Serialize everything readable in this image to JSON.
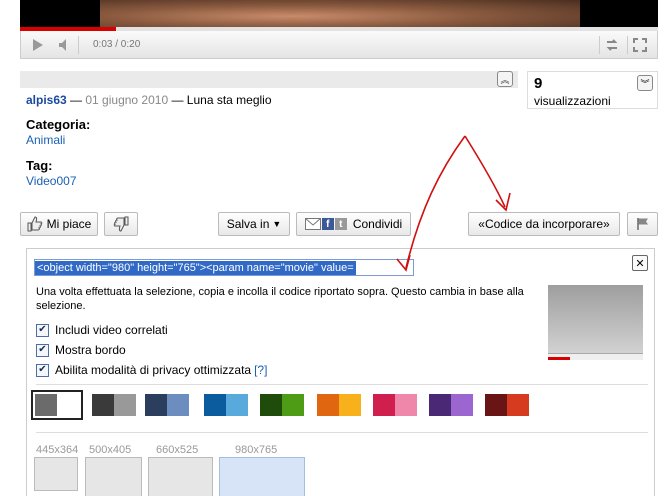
{
  "player": {
    "time": "0:03 / 0:20",
    "played_fraction": 0.15
  },
  "info": {
    "views_count": "9",
    "views_label": "visualizzazioni",
    "username": "alpis63",
    "sep1": " — ",
    "date": "01 giugno 2010",
    "sep2": " — ",
    "title": "Luna sta meglio",
    "category_label": "Categoria:",
    "category_value": "Animali",
    "tag_label": "Tag:",
    "tag_value": "Video007"
  },
  "actions": {
    "like_label": "Mi piace",
    "save_label": "Salva in",
    "share_label": "Condividi",
    "embed_label": "«Codice da incorporare»"
  },
  "embed": {
    "code": "<object width=\"980\" height=\"765\"><param name=\"movie\" value=",
    "description": "Una volta effettuata la selezione, copia e incolla il codice riportato sopra. Questo cambia in base alla selezione.",
    "options": [
      {
        "label": "Includi video correlati",
        "checked": true
      },
      {
        "label": "Mostra bordo",
        "checked": true
      },
      {
        "label": "Abilita modalità di privacy ottimizzata",
        "checked": true,
        "help": "[?]"
      }
    ],
    "colors": [
      {
        "a": "#6b6b6b",
        "b": "#ffffff",
        "selected": true
      },
      {
        "a": "#3a3a3a",
        "b": "#999999"
      },
      {
        "a": "#2b3e5e",
        "b": "#6c8dbf"
      },
      {
        "a": "#0a5c9e",
        "b": "#58a9dc"
      },
      {
        "a": "#1f4b0b",
        "b": "#4e9b16"
      },
      {
        "a": "#e0670f",
        "b": "#f9b11b"
      },
      {
        "a": "#d01f4f",
        "b": "#ee87a9"
      },
      {
        "a": "#4a2876",
        "b": "#9b66cf"
      },
      {
        "a": "#6a1515",
        "b": "#d63a1f"
      }
    ],
    "sizes": [
      {
        "label": "445x364"
      },
      {
        "label": "500x405"
      },
      {
        "label": "660x525"
      },
      {
        "label": "980x765",
        "selected": true
      }
    ]
  }
}
